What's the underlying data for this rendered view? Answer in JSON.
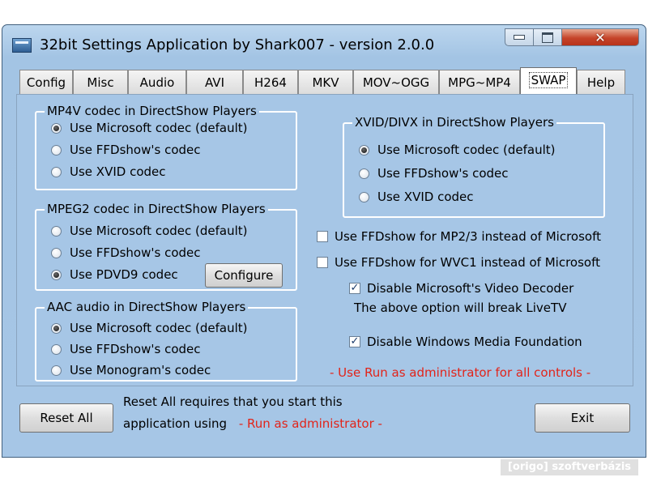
{
  "window": {
    "title": "32bit Settings Application by Shark007 - version 2.0.0"
  },
  "tabs": [
    {
      "label": "Config"
    },
    {
      "label": "Misc"
    },
    {
      "label": "Audio"
    },
    {
      "label": "AVI"
    },
    {
      "label": "H264"
    },
    {
      "label": "MKV"
    },
    {
      "label": "MOV~OGG"
    },
    {
      "label": "MPG~MP4"
    },
    {
      "label": "SWAP",
      "active": true
    },
    {
      "label": "Help"
    }
  ],
  "groups": {
    "mp4v": {
      "legend": "MP4V codec in DirectShow Players",
      "options": [
        {
          "label": "Use Microsoft codec (default)",
          "selected": true
        },
        {
          "label": "Use FFDshow's codec",
          "selected": false
        },
        {
          "label": "Use XVID codec",
          "selected": false
        }
      ]
    },
    "mpeg2": {
      "legend": "MPEG2 codec in DirectShow Players",
      "options": [
        {
          "label": "Use Microsoft codec (default)",
          "selected": false
        },
        {
          "label": "Use FFDshow's codec",
          "selected": false
        },
        {
          "label": "Use PDVD9 codec",
          "selected": true
        }
      ],
      "configure_label": "Configure"
    },
    "aac": {
      "legend": "AAC audio in DirectShow Players",
      "options": [
        {
          "label": "Use Microsoft codec (default)",
          "selected": true
        },
        {
          "label": "Use FFDshow's codec",
          "selected": false
        },
        {
          "label": "Use Monogram's codec",
          "selected": false
        }
      ]
    },
    "xvid": {
      "legend": "XVID/DIVX in DirectShow Players",
      "options": [
        {
          "label": "Use Microsoft codec (default)",
          "selected": true
        },
        {
          "label": "Use FFDshow's codec",
          "selected": false
        },
        {
          "label": "Use XVID codec",
          "selected": false
        }
      ]
    }
  },
  "checkboxes": [
    {
      "label": "Use FFDshow for MP2/3 instead of Microsoft",
      "checked": false
    },
    {
      "label": "Use FFDshow for WVC1 instead of Microsoft",
      "checked": false
    },
    {
      "label": "Disable Microsoft's Video Decoder",
      "checked": true
    },
    {
      "label": "Disable Windows Media Foundation",
      "checked": true
    }
  ],
  "note_livetv": "The above option will break LiveTV",
  "admin_note": "- Use Run as administrator for all controls -",
  "footer": {
    "reset_label": "Reset All",
    "reset_note_line1": "Reset All requires that you start this",
    "reset_note_line2": "application using",
    "reset_note_red": "- Run as administrator -",
    "exit_label": "Exit"
  },
  "watermark": "[origo] szoftverbázis",
  "colors": {
    "admin_text": "#e2241a",
    "window_bg": "#a6c6e6",
    "close_button": "#c5442a"
  }
}
